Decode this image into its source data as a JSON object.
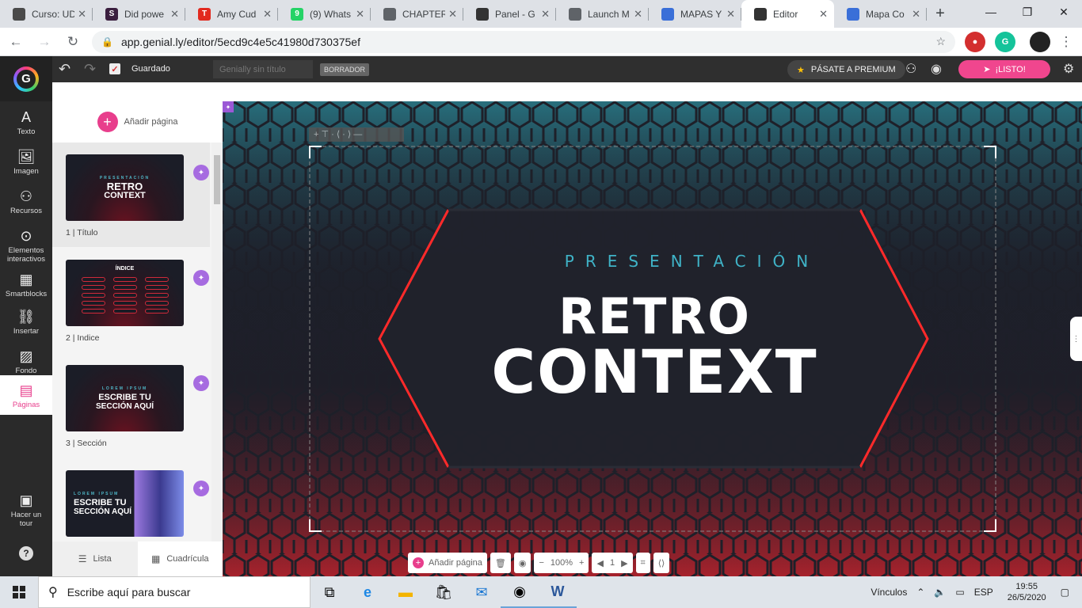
{
  "browser": {
    "tabs": [
      {
        "title": "Curso: UD",
        "favicon_color": "#4a4a4a"
      },
      {
        "title": "Did powe",
        "favicon_color": "#3b1f3f",
        "favicon_letter": "S"
      },
      {
        "title": "Amy Cud",
        "favicon_color": "#e22a1f",
        "favicon_letter": "T"
      },
      {
        "title": "(9) Whats",
        "favicon_color": "#25d366",
        "favicon_letter": "9"
      },
      {
        "title": "CHAPTER",
        "favicon_color": "#5f6368"
      },
      {
        "title": "Panel - G",
        "favicon_color": "#333"
      },
      {
        "title": "Launch M",
        "favicon_color": "#5f6368"
      },
      {
        "title": "MAPAS Y",
        "favicon_color": "#3a6fd8"
      },
      {
        "title": "Editor",
        "favicon_color": "#333"
      },
      {
        "title": "Mapa Co",
        "favicon_color": "#3a6fd8"
      }
    ],
    "active_tab_index": 8,
    "url": "app.genial.ly/editor/5ecd9c4e5c41980d730375ef"
  },
  "editor": {
    "saved_label": "Guardado",
    "title_placeholder": "Genially sin título",
    "draft_badge": "BORRADOR",
    "premium_label": "PÁSATE A PREMIUM",
    "ready_label": "¡LISTO!"
  },
  "leftnav": {
    "items": [
      {
        "label": "Texto",
        "icon": "A"
      },
      {
        "label": "Imagen",
        "icon": "🖼"
      },
      {
        "label": "Recursos",
        "icon": "⚇"
      },
      {
        "label": "Elementos interactivos",
        "icon": "⊙"
      },
      {
        "label": "Smartblocks",
        "icon": "▦"
      },
      {
        "label": "Insertar",
        "icon": "⛓"
      },
      {
        "label": "Fondo",
        "icon": "▨"
      },
      {
        "label": "Páginas",
        "icon": "▤"
      }
    ],
    "tour_label": "Hacer un tour",
    "help_icon": "?"
  },
  "pages_panel": {
    "add_page_label": "Añadir página",
    "pages": [
      {
        "label": "1 | Título",
        "kicker": "PRESENTACIÓN",
        "line1": "RETRO",
        "line2": "CONTEXT"
      },
      {
        "label": "2 | Indice",
        "line1": "ÍNDICE"
      },
      {
        "label": "3 | Sección",
        "kicker": "LOREM IPSUM",
        "line1": "ESCRIBE TU",
        "line2": "SECCIÓN AQUÍ"
      },
      {
        "label": "",
        "kicker": "LOREM IPSUM",
        "line1": "ESCRIBE TU",
        "line2": "SECCIÓN AQUÍ"
      }
    ],
    "view_list_label": "Lista",
    "view_grid_label": "Cuadrícula"
  },
  "slide": {
    "subtitle": "PRESENTACIÓN",
    "title_line1": "RETRO",
    "title_line2": "CONTEXT"
  },
  "canvas_toolbar": {
    "add_page_label": "Añadir página",
    "zoom": "100%",
    "page_number": "1"
  },
  "taskbar": {
    "search_placeholder": "Escribe aquí para buscar",
    "tray_links": "Vínculos",
    "language": "ESP",
    "time": "19:55",
    "date": "26/5/2020"
  }
}
